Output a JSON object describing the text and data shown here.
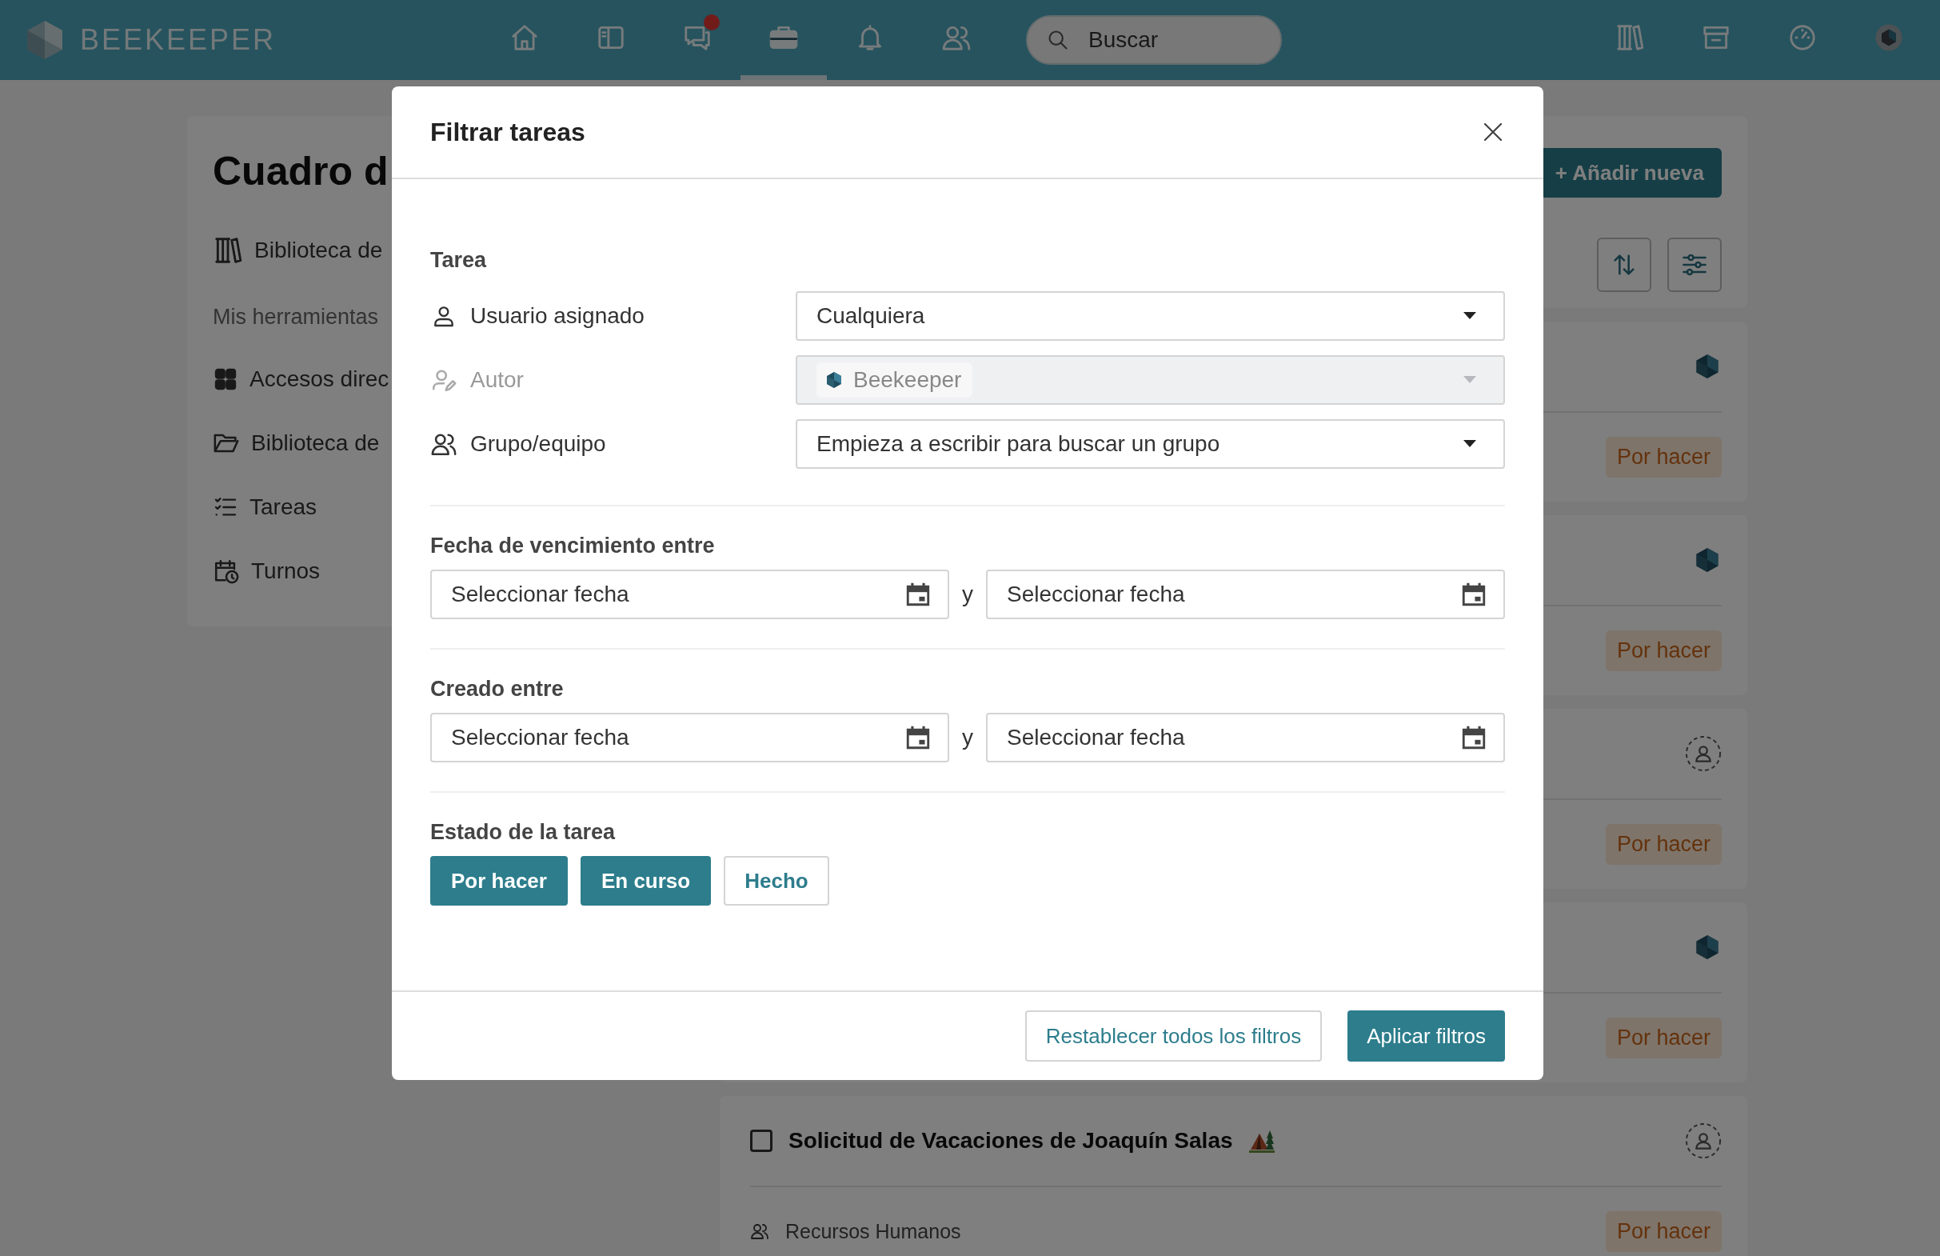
{
  "topbar": {
    "logo_text": "BEEKEEPER",
    "nav": [
      {
        "kind": "home",
        "selected": false,
        "badge": false
      },
      {
        "kind": "panel",
        "selected": false,
        "badge": false
      },
      {
        "kind": "chat",
        "selected": false,
        "badge": true
      },
      {
        "kind": "toolbox",
        "selected": true,
        "badge": false
      },
      {
        "kind": "bell",
        "selected": false,
        "badge": false
      },
      {
        "kind": "people",
        "selected": false,
        "badge": false
      }
    ],
    "search": {
      "placeholder": "Buscar"
    },
    "tools": [
      {
        "kind": "library"
      },
      {
        "kind": "store"
      },
      {
        "kind": "dashboard"
      },
      {
        "kind": "avatar"
      }
    ]
  },
  "sidebar": {
    "title": "Cuadro d",
    "library_link": "Biblioteca de",
    "section": "Mis herramientas",
    "items": [
      {
        "kind": "grid",
        "label": "Accesos direc"
      },
      {
        "kind": "folder",
        "label": "Biblioteca de"
      },
      {
        "kind": "checklist",
        "label": "Tareas"
      },
      {
        "kind": "calendar",
        "label": "Turnos"
      }
    ]
  },
  "toolbar": {
    "add_button": "+ Añadir nueva"
  },
  "tasks": [
    {
      "assignee": {
        "kind": "logo"
      },
      "status": "Por hacer"
    },
    {
      "assignee": {
        "kind": "logo"
      },
      "status": "Por hacer"
    },
    {
      "assignee": {
        "kind": "none"
      },
      "status": "Por hacer"
    },
    {
      "assignee": {
        "kind": "logo"
      },
      "status": "Por hacer"
    },
    {
      "assignee": {
        "kind": "none"
      },
      "title": "Solicitud de Vacaciones de Joaquín Salas",
      "group": "Recursos Humanos",
      "checked": false,
      "status": "Por hacer"
    }
  ],
  "modal": {
    "title": "Filtrar tareas",
    "sections": [
      {
        "kind": "fields",
        "title": "Tarea",
        "fields": [
          {
            "kind": "user",
            "label": "Usuario asignado",
            "value": "Cualquiera",
            "disabled": false
          },
          {
            "kind": "author",
            "label": "Autor",
            "chip": "Beekeeper",
            "disabled": true
          },
          {
            "kind": "group",
            "label": "Grupo/equipo",
            "placeholder": "Empieza a escribir para buscar un grupo",
            "disabled": false
          }
        ]
      },
      {
        "kind": "dates",
        "title": "Fecha de vencimiento entre",
        "from": {
          "placeholder": "Seleccionar fecha"
        },
        "separator": "y",
        "to": {
          "placeholder": "Seleccionar fecha"
        }
      },
      {
        "kind": "dates",
        "title": "Creado entre",
        "from": {
          "placeholder": "Seleccionar fecha"
        },
        "separator": "y",
        "to": {
          "placeholder": "Seleccionar fecha"
        }
      },
      {
        "kind": "status",
        "title": "Estado de la tarea",
        "options": [
          {
            "label": "Por hacer",
            "selected": true
          },
          {
            "label": "En curso",
            "selected": true
          },
          {
            "label": "Hecho",
            "selected": false
          }
        ]
      }
    ],
    "buttons": {
      "reset": "Restablecer todos los filtros",
      "apply": "Aplicar filtros"
    }
  }
}
